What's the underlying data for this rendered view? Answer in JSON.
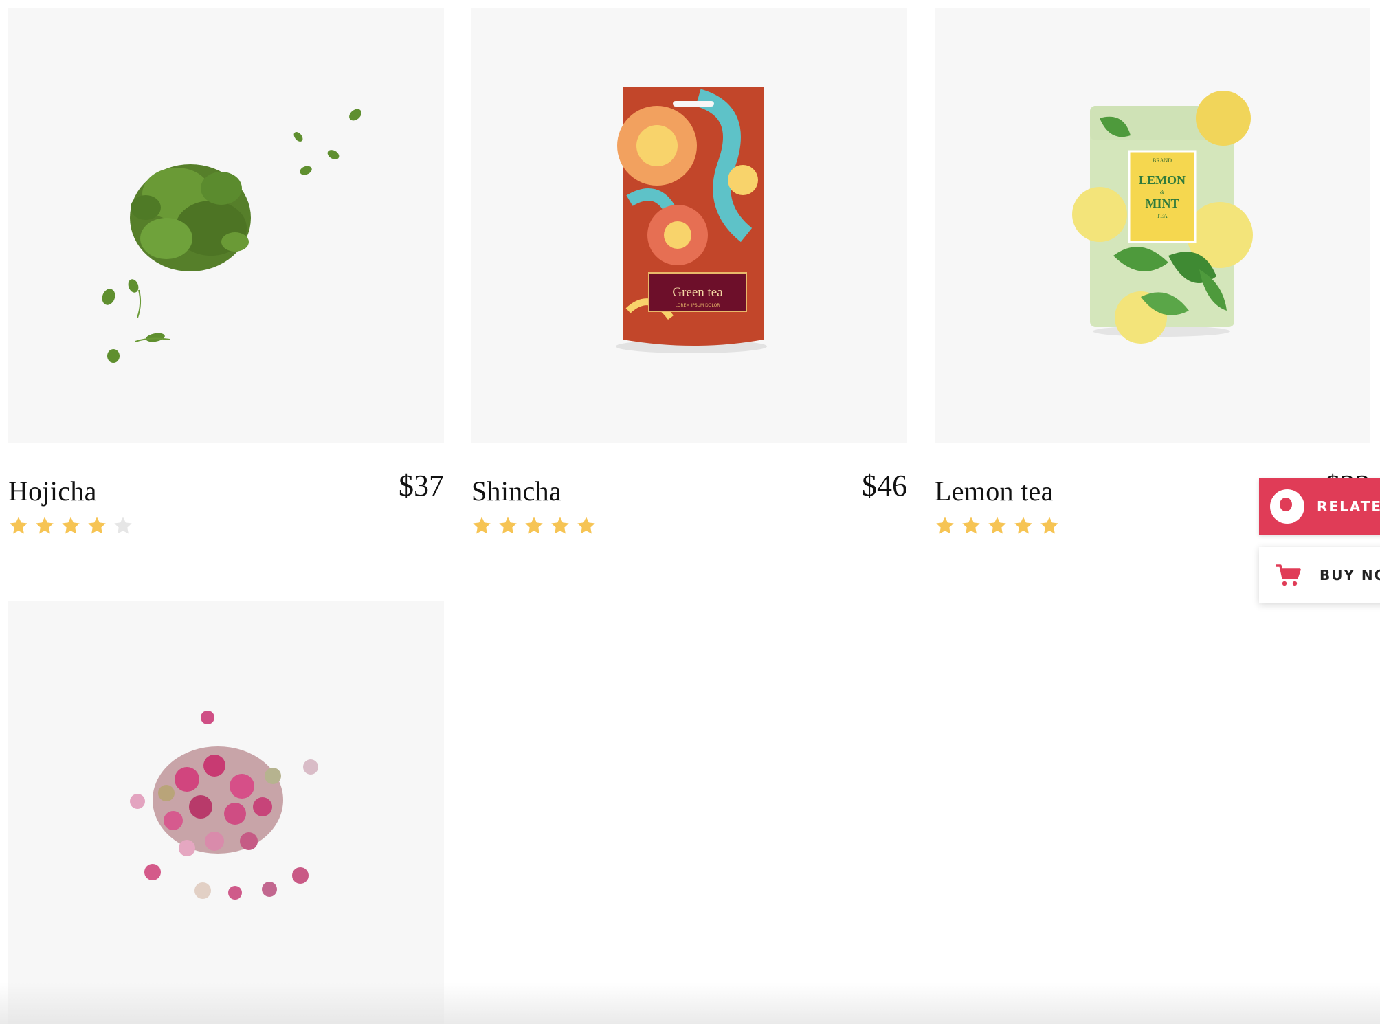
{
  "products": [
    {
      "name": "Hojicha",
      "price": "$37",
      "rating": 4,
      "max_rating": 5,
      "image": "loose-green-tea-leaves"
    },
    {
      "name": "Shincha",
      "price": "$46",
      "rating": 5,
      "max_rating": 5,
      "image": "green-tea-pouch",
      "package_text": "Green tea",
      "package_subtext": "LOREM IPSUM DOLOR"
    },
    {
      "name": "Lemon tea",
      "price": "$22",
      "rating": 5,
      "max_rating": 5,
      "image": "lemon-mint-tea-tin",
      "package_brand": "BRAND",
      "package_line1": "LEMON",
      "package_amp": "&",
      "package_line2": "MINT",
      "package_line3": "TEA"
    },
    {
      "name": "",
      "price": "",
      "image": "dried-rose-buds"
    }
  ],
  "floating": {
    "related_label": "RELATED",
    "buy_label": "BUY NOW"
  },
  "colors": {
    "star_filled": "#f6c454",
    "star_empty": "#e6e6e6",
    "accent": "#e03c57",
    "tile_bg": "#f7f7f7"
  }
}
